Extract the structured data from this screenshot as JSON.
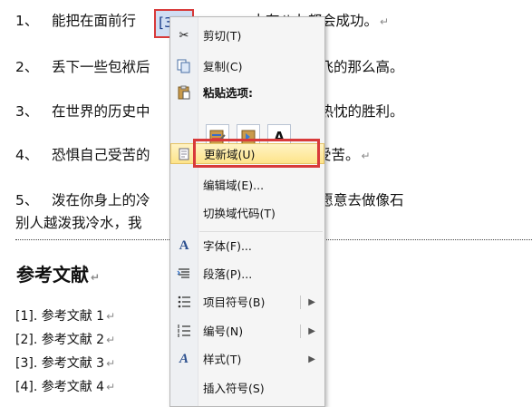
{
  "document": {
    "lines": [
      {
        "num": "1、",
        "text": "能把在面前行",
        "tail": "，十有八九都会成功。"
      },
      {
        "num": "2、",
        "text": "丢下一些包袱后",
        "tail": "原来自己可以飞的那么高。"
      },
      {
        "num": "3、",
        "text": "在世界的历史中",
        "tail": "时刻都是某种热忱的胜利。"
      },
      {
        "num": "4、",
        "text": "恐惧自己受苦的",
        "tail": "恐惧在受苦。"
      },
      {
        "num": "5、",
        "text": "泼在你身上的冷",
        "tail": "回去。但我更愿意去做像石"
      }
    ],
    "line6": "别人越泼我冷水，我",
    "field_fragment": "[3",
    "heading": "参考文献",
    "refs": [
      "[1]. 参考文献 1",
      "[2]. 参考文献 2",
      "[3]. 参考文献 3",
      "[4]. 参考文献 4"
    ],
    "para_mark": "↵"
  },
  "context_menu": {
    "cut": "剪切(T)",
    "copy": "复制(C)",
    "paste_options": "粘贴选项:",
    "paste_a": "A",
    "update_field": "更新域(U)",
    "edit_field": "编辑域(E)...",
    "toggle_field_codes": "切换域代码(T)",
    "font": "字体(F)...",
    "paragraph": "段落(P)...",
    "bullets": "项目符号(B)",
    "numbering": "编号(N)",
    "styles": "样式(T)",
    "insert_symbol": "插入符号(S)"
  }
}
